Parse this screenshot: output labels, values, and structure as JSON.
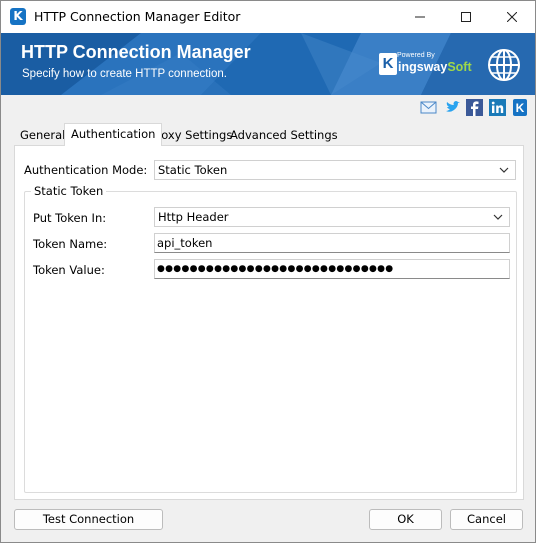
{
  "window": {
    "title": "HTTP Connection Manager Editor",
    "controls": [
      "minimize",
      "maximize",
      "close"
    ]
  },
  "banner": {
    "title": "HTTP Connection Manager",
    "subtitle": "Specify how to create HTTP connection.",
    "brand_powered": "Powered By",
    "brand_k": "K",
    "brand_name_main": "ingsway",
    "brand_name_accent": "Soft",
    "brand_color": "#1a5fa8",
    "accent_color": "#9fd84a"
  },
  "social": [
    "mail-icon",
    "twitter-icon",
    "facebook-icon",
    "linkedin-icon",
    "kingswaysoft-icon"
  ],
  "tabs": [
    {
      "label": "General",
      "active": false
    },
    {
      "label": "Authentication",
      "active": true
    },
    {
      "label": "Proxy Settings",
      "active": false
    },
    {
      "label": "Advanced Settings",
      "active": false
    }
  ],
  "form": {
    "auth_mode_label": "Authentication Mode:",
    "auth_mode_value": "Static Token",
    "group_label": "Static Token",
    "put_token_label": "Put Token In:",
    "put_token_value": "Http Header",
    "token_name_label": "Token Name:",
    "token_name_value": "api_token",
    "token_value_label": "Token Value:",
    "token_value_masked": "●●●●●●●●●●●●●●●●●●●●●●●●●●●●●"
  },
  "buttons": {
    "test": "Test Connection",
    "ok": "OK",
    "cancel": "Cancel"
  }
}
